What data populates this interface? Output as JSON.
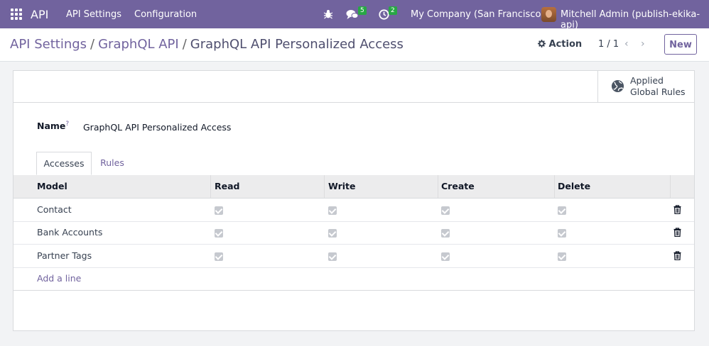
{
  "navbar": {
    "brand": "API",
    "menus": [
      "API Settings",
      "Configuration"
    ],
    "messages_count": "5",
    "activities_count": "2",
    "company": "My Company (San Francisco)",
    "user": "Mitchell Admin (publish-ekika-api)",
    "icons": [
      "apps-grid-icon",
      "bug-icon",
      "chat-icon",
      "clock-icon"
    ]
  },
  "breadcrumb": {
    "items": [
      "API Settings",
      "GraphQL API"
    ],
    "current": "GraphQL API Personalized Access"
  },
  "control": {
    "action_label": "Action",
    "pager": "1 / 1",
    "new_label": "New"
  },
  "smart_button": {
    "line1": "Applied",
    "line2": "Global Rules"
  },
  "form": {
    "name_label": "Name",
    "name_help": "?",
    "name_value": "GraphQL API Personalized Access"
  },
  "tabs": [
    "Accesses",
    "Rules"
  ],
  "table": {
    "headers": [
      "Model",
      "Read",
      "Write",
      "Create",
      "Delete"
    ],
    "rows": [
      {
        "model": "Contact",
        "read": true,
        "write": true,
        "create": true,
        "delete": true
      },
      {
        "model": "Bank Accounts",
        "read": true,
        "write": true,
        "create": true,
        "delete": true
      },
      {
        "model": "Partner Tags",
        "read": true,
        "write": true,
        "create": true,
        "delete": true
      }
    ],
    "add_line": "Add a line"
  },
  "colors": {
    "brand": "#71639e",
    "badge": "#28a745"
  }
}
